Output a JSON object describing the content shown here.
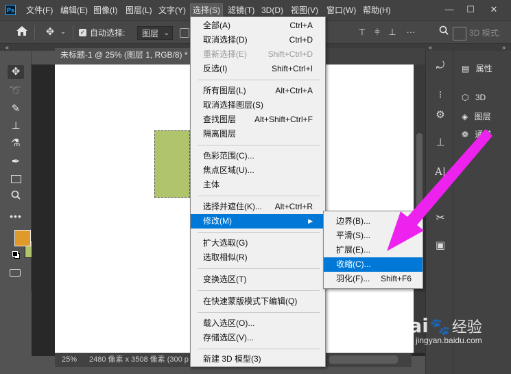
{
  "app": {
    "logo": "Ps"
  },
  "menubar": {
    "items": [
      "文件(F)",
      "编辑(E)",
      "图像(I)",
      "图层(L)",
      "文字(Y)",
      "选择(S)",
      "滤镜(T)",
      "3D(D)",
      "视图(V)",
      "窗口(W)",
      "帮助(H)"
    ],
    "active": "选择(S)",
    "window_controls": [
      "—",
      "☐",
      "✕"
    ]
  },
  "options": {
    "auto_select_label": "自动选择:",
    "auto_select_checked": true,
    "layer_select_value": "图层",
    "mode_3d_label": "3D 模式:"
  },
  "document": {
    "tab_title": "未标题-1 @ 25% (图层 1, RGB/8) *",
    "zoom": "25%",
    "status_info": "2480 像素 x 3508 像素 (300 p",
    "shape_color": "#b0c46b"
  },
  "tools": {
    "foreground_color": "#e09a2a",
    "background_color": "#b0c46b"
  },
  "panels": {
    "properties": "属性",
    "three_d": "3D",
    "layers": "图层",
    "channels": "通道"
  },
  "select_menu": {
    "items": [
      {
        "label": "全部(A)",
        "shortcut": "Ctrl+A"
      },
      {
        "label": "取消选择(D)",
        "shortcut": "Ctrl+D"
      },
      {
        "label": "重新选择(E)",
        "shortcut": "Shift+Ctrl+D"
      },
      {
        "label": "反选(I)",
        "shortcut": "Shift+Ctrl+I"
      },
      {
        "label": "所有图层(L)",
        "shortcut": "Alt+Ctrl+A"
      },
      {
        "label": "取消选择图层(S)",
        "shortcut": ""
      },
      {
        "label": "查找图层",
        "shortcut": "Alt+Shift+Ctrl+F"
      },
      {
        "label": "隔离图层",
        "shortcut": ""
      },
      {
        "label": "色彩范围(C)...",
        "shortcut": ""
      },
      {
        "label": "焦点区域(U)...",
        "shortcut": ""
      },
      {
        "label": "主体",
        "shortcut": ""
      },
      {
        "label": "选择并遮住(K)...",
        "shortcut": "Alt+Ctrl+R"
      },
      {
        "label": "修改(M)",
        "shortcut": ""
      },
      {
        "label": "扩大选取(G)",
        "shortcut": ""
      },
      {
        "label": "选取相似(R)",
        "shortcut": ""
      },
      {
        "label": "变换选区(T)",
        "shortcut": ""
      },
      {
        "label": "在快速蒙版模式下编辑(Q)",
        "shortcut": ""
      },
      {
        "label": "载入选区(O)...",
        "shortcut": ""
      },
      {
        "label": "存储选区(V)...",
        "shortcut": ""
      },
      {
        "label": "新建 3D 模型(3)",
        "shortcut": ""
      }
    ]
  },
  "modify_submenu": {
    "items": [
      {
        "label": "边界(B)...",
        "shortcut": ""
      },
      {
        "label": "平滑(S)...",
        "shortcut": ""
      },
      {
        "label": "扩展(E)...",
        "shortcut": ""
      },
      {
        "label": "收缩(C)...",
        "shortcut": ""
      },
      {
        "label": "羽化(F)...",
        "shortcut": "Shift+F6"
      }
    ]
  },
  "watermark": {
    "brand": "Bai",
    "brand_suffix": "经验",
    "url": "jingyan.baidu.com"
  }
}
